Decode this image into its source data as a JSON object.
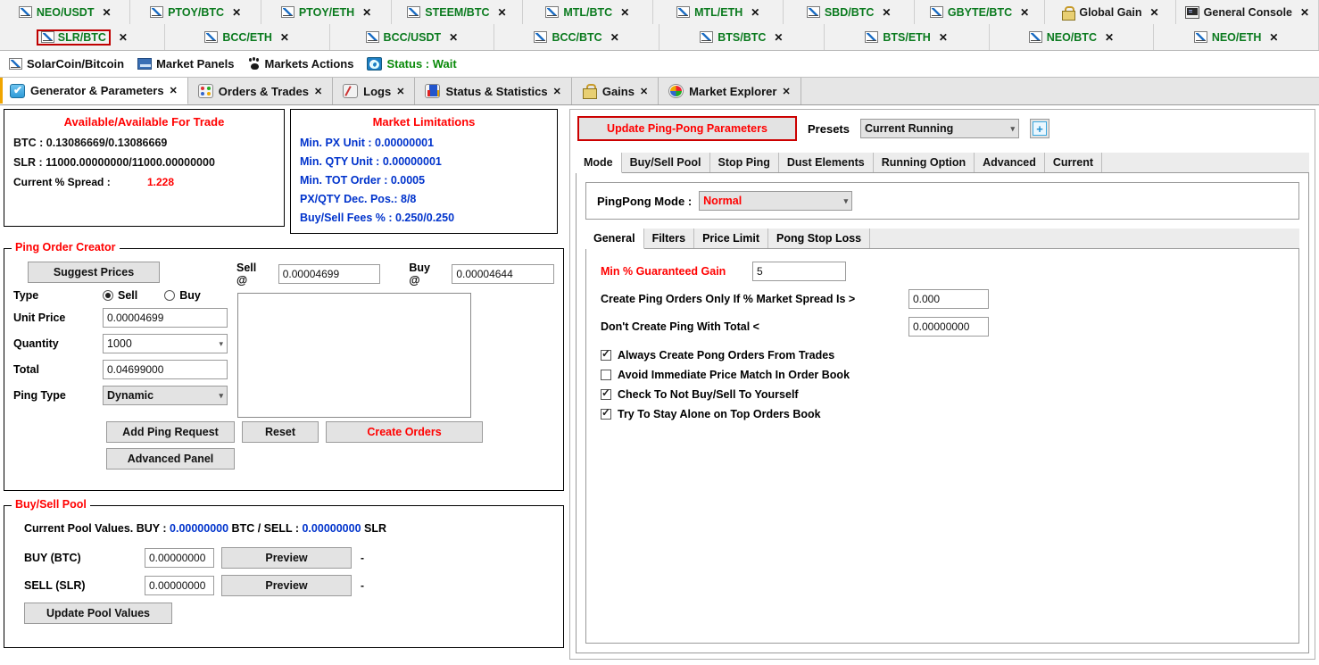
{
  "market_tabs": {
    "row1": [
      {
        "label": "NEO/USDT",
        "icon": "chart-icon",
        "active": false
      },
      {
        "label": "PTOY/BTC",
        "icon": "chart-icon",
        "active": false
      },
      {
        "label": "PTOY/ETH",
        "icon": "chart-icon",
        "active": false
      },
      {
        "label": "STEEM/BTC",
        "icon": "chart-icon",
        "active": false
      },
      {
        "label": "MTL/BTC",
        "icon": "chart-icon",
        "active": false
      },
      {
        "label": "MTL/ETH",
        "icon": "chart-icon",
        "active": false
      },
      {
        "label": "SBD/BTC",
        "icon": "chart-icon",
        "active": false
      },
      {
        "label": "GBYTE/BTC",
        "icon": "chart-icon",
        "active": false
      },
      {
        "label": "Global Gain",
        "icon": "lock-icon",
        "active": false
      },
      {
        "label": "General Console",
        "icon": "console-icon",
        "active": false
      }
    ],
    "row2": [
      {
        "label": "SLR/BTC",
        "icon": "chart-icon",
        "active": true
      },
      {
        "label": "BCC/ETH",
        "icon": "chart-icon",
        "active": false
      },
      {
        "label": "BCC/USDT",
        "icon": "chart-icon",
        "active": false
      },
      {
        "label": "BCC/BTC",
        "icon": "chart-icon",
        "active": false
      },
      {
        "label": "BTS/BTC",
        "icon": "chart-icon",
        "active": false
      },
      {
        "label": "BTS/ETH",
        "icon": "chart-icon",
        "active": false
      },
      {
        "label": "NEO/BTC",
        "icon": "chart-icon",
        "active": false
      },
      {
        "label": "NEO/ETH",
        "icon": "chart-icon",
        "active": false
      }
    ],
    "close_glyph": "✕"
  },
  "toolbar": {
    "market_name": "SolarCoin/Bitcoin",
    "market_panels": "Market Panels",
    "markets_actions": "Markets Actions",
    "status": "Status : Wait",
    "status_color": "#0a8a0a"
  },
  "main_tabs": [
    {
      "label": "Generator & Parameters",
      "icon": "generator-icon",
      "active": true
    },
    {
      "label": "Orders & Trades",
      "icon": "orders-icon",
      "active": false
    },
    {
      "label": "Logs",
      "icon": "logs-icon",
      "active": false
    },
    {
      "label": "Status & Statistics",
      "icon": "statistics-icon",
      "active": false
    },
    {
      "label": "Gains",
      "icon": "gains-icon",
      "active": false
    },
    {
      "label": "Market Explorer",
      "icon": "explorer-icon",
      "active": false
    }
  ],
  "available": {
    "title": "Available/Available For Trade",
    "btc_line": "BTC : 0.13086669/0.13086669",
    "slr_line": "SLR : 11000.00000000/11000.00000000",
    "spread_label": "Current % Spread :",
    "spread_value": "1.228"
  },
  "market_limitations": {
    "title": "Market Limitations",
    "lines": [
      "Min. PX  Unit  : 0.00000001",
      "Min. QTY Unit  : 0.00000001",
      "Min. TOT Order  : 0.0005",
      "PX/QTY Dec. Pos.: 8/8",
      "Buy/Sell Fees % : 0.250/0.250"
    ]
  },
  "ping_order_creator": {
    "title": "Ping Order Creator",
    "suggest_prices": "Suggest Prices",
    "sell_at_label": "Sell @",
    "sell_at_value": "0.00004699",
    "buy_at_label": "Buy @",
    "buy_at_value": "0.00004644",
    "type_label": "Type",
    "type_sell": "Sell",
    "type_buy": "Buy",
    "type_selected": "Sell",
    "unit_price_label": "Unit Price",
    "unit_price_value": "0.00004699",
    "quantity_label": "Quantity",
    "quantity_value": "1000",
    "total_label": "Total",
    "total_value": "0.04699000",
    "ping_type_label": "Ping Type",
    "ping_type_value": "Dynamic",
    "add_ping_request": "Add Ping Request",
    "reset": "Reset",
    "create_orders": "Create Orders",
    "advanced_panel": "Advanced Panel",
    "request_list": ""
  },
  "buy_sell_pool": {
    "title": "Buy/Sell Pool",
    "current_prefix": "Current Pool Values. BUY : ",
    "buy_value": "0.00000000",
    "buy_unit": " BTC / SELL : ",
    "sell_value": "0.00000000",
    "sell_unit": " SLR",
    "buy_label": "BUY (BTC)",
    "buy_input": "0.00000000",
    "sell_label": "SELL (SLR)",
    "sell_input": "0.00000000",
    "preview": "Preview",
    "dash": "-",
    "update_pool_values": "Update Pool Values"
  },
  "right_panel": {
    "update_button": "Update Ping-Pong Parameters",
    "presets_label": "Presets",
    "presets_value": "Current Running",
    "add_preset_glyph": "+",
    "tabs": [
      {
        "label": "Mode",
        "active": true
      },
      {
        "label": "Buy/Sell Pool",
        "active": false
      },
      {
        "label": "Stop Ping",
        "active": false
      },
      {
        "label": "Dust Elements",
        "active": false
      },
      {
        "label": "Running Option",
        "active": false
      },
      {
        "label": "Advanced",
        "active": false
      },
      {
        "label": "Current",
        "active": false
      }
    ],
    "mode_label": "PingPong Mode :",
    "mode_value": "Normal",
    "sub_tabs": [
      {
        "label": "General",
        "active": true
      },
      {
        "label": "Filters",
        "active": false
      },
      {
        "label": "Price Limit",
        "active": false
      },
      {
        "label": "Pong Stop Loss",
        "active": false
      }
    ],
    "general": {
      "min_gain_label": "Min % Guaranteed Gain",
      "min_gain_value": "5",
      "market_spread_label": "Create Ping Orders Only If % Market Spread Is >",
      "market_spread_value": "0.000",
      "dont_create_label": "Don't Create Ping With Total <",
      "dont_create_value": "0.00000000",
      "checkboxes": [
        {
          "label": "Always Create Pong Orders From Trades",
          "checked": true
        },
        {
          "label": "Avoid Immediate Price Match In Order Book",
          "checked": false
        },
        {
          "label": "Check To Not Buy/Sell To Yourself",
          "checked": true
        },
        {
          "label": "Try To Stay Alone on Top Orders Book",
          "checked": true
        }
      ]
    }
  }
}
